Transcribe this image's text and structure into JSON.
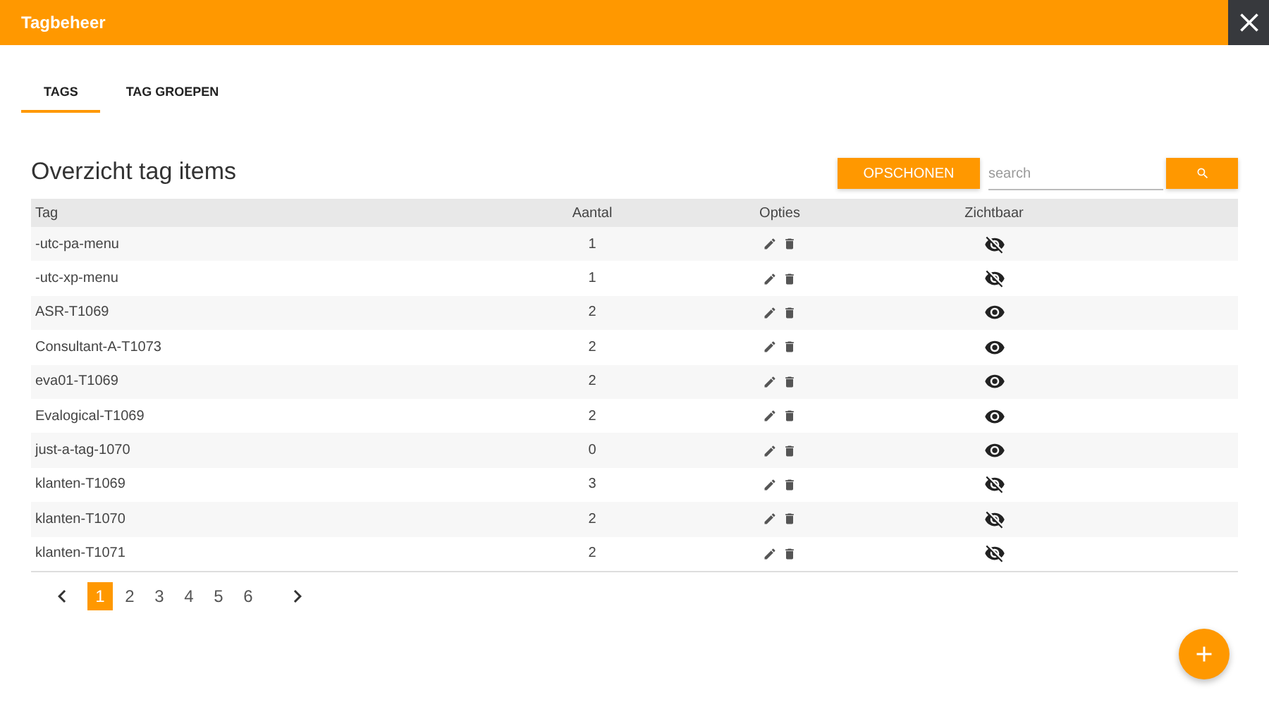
{
  "window": {
    "title": "Tagbeheer"
  },
  "tabs": [
    {
      "label": "TAGS",
      "selected": true
    },
    {
      "label": "TAG GROEPEN",
      "selected": false
    }
  ],
  "section_title": "Overzicht tag items",
  "cleanup_button": "OPSCHONEN",
  "search": {
    "placeholder": "search"
  },
  "table": {
    "columns": [
      "Tag",
      "Aantal",
      "Opties",
      "Zichtbaar"
    ],
    "rows": [
      {
        "tag": "-utc-pa-menu",
        "count": "1",
        "visible": false
      },
      {
        "tag": "-utc-xp-menu",
        "count": "1",
        "visible": false
      },
      {
        "tag": "ASR-T1069",
        "count": "2",
        "visible": true
      },
      {
        "tag": "Consultant-A-T1073",
        "count": "2",
        "visible": true
      },
      {
        "tag": "eva01-T1069",
        "count": "2",
        "visible": true
      },
      {
        "tag": "Evalogical-T1069",
        "count": "2",
        "visible": true
      },
      {
        "tag": "just-a-tag-1070",
        "count": "0",
        "visible": true
      },
      {
        "tag": "klanten-T1069",
        "count": "3",
        "visible": false
      },
      {
        "tag": "klanten-T1070",
        "count": "2",
        "visible": false
      },
      {
        "tag": "klanten-T1071",
        "count": "2",
        "visible": false
      }
    ]
  },
  "pagination": [
    {
      "label": "1",
      "selected": true
    },
    {
      "label": "2",
      "selected": false
    },
    {
      "label": "3",
      "selected": false
    },
    {
      "label": "4",
      "selected": false
    },
    {
      "label": "5",
      "selected": false
    },
    {
      "label": "6",
      "selected": false
    }
  ]
}
